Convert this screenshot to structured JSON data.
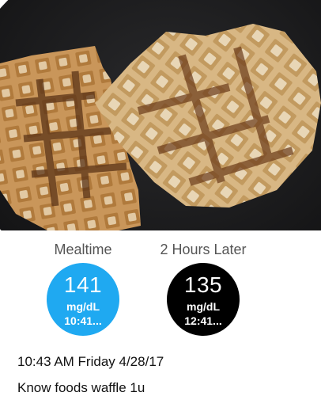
{
  "photo": {
    "description_icon": "waffle-photo"
  },
  "readings": {
    "mealtime": {
      "label": "Mealtime",
      "value": "141",
      "unit": "mg/dL",
      "time": "10:41...",
      "color": "#1fa9f1"
    },
    "later": {
      "label": "2 Hours Later",
      "value": "135",
      "unit": "mg/dL",
      "time": "12:41...",
      "color": "#000000"
    }
  },
  "entry": {
    "datetime": "10:43 AM Friday 4/28/17",
    "note": "Know foods waffle 1u"
  }
}
